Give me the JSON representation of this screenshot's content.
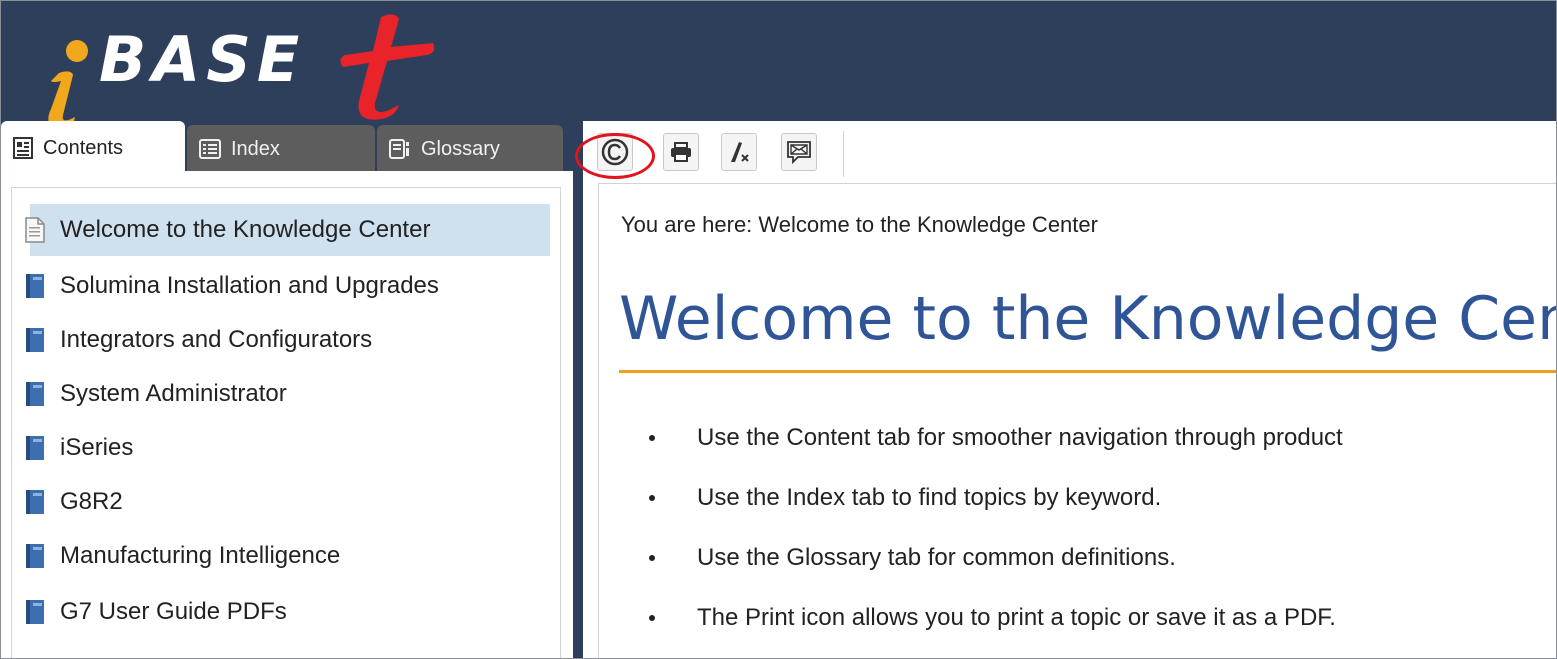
{
  "header": {
    "logo_text": "BASE",
    "logo_alt": "iBASEt"
  },
  "tabs": [
    {
      "label": "Contents",
      "icon": "contents-icon",
      "active": true
    },
    {
      "label": "Index",
      "icon": "index-icon",
      "active": false
    },
    {
      "label": "Glossary",
      "icon": "glossary-icon",
      "active": false
    }
  ],
  "tree": {
    "items": [
      {
        "label": "Welcome to the Knowledge Center",
        "icon": "topic-page-icon",
        "selected": true
      },
      {
        "label": "Solumina Installation and Upgrades",
        "icon": "book-icon",
        "selected": false
      },
      {
        "label": "Integrators and Configurators",
        "icon": "book-icon",
        "selected": false
      },
      {
        "label": "System Administrator",
        "icon": "book-icon",
        "selected": false
      },
      {
        "label": "iSeries",
        "icon": "book-icon",
        "selected": false
      },
      {
        "label": "G8R2",
        "icon": "book-icon",
        "selected": false
      },
      {
        "label": "Manufacturing Intelligence",
        "icon": "book-icon",
        "selected": false
      },
      {
        "label": "G7 User Guide PDFs",
        "icon": "book-icon",
        "selected": false
      }
    ]
  },
  "toolbar": {
    "buttons": [
      "copyright-icon",
      "print-icon",
      "clear-highlight-icon",
      "email-icon"
    ]
  },
  "content": {
    "breadcrumb": "You are here: Welcome to the Knowledge Center",
    "heading": "Welcome to the Knowledge Center",
    "bullets": [
      "Use the Content tab for smoother navigation through product",
      "Use the Index tab to find topics by keyword.",
      "Use the Glossary tab for common definitions.",
      "The Print icon allows you to print a topic or save it as a PDF."
    ]
  },
  "colors": {
    "header_bg": "#2e3f5c",
    "heading": "#2f5597",
    "rule": "#f0a020",
    "selected_bg": "#cfe0ee",
    "annotation": "#e0141e",
    "logo_accent": "#e8232a",
    "logo_i": "#f2a81d"
  }
}
